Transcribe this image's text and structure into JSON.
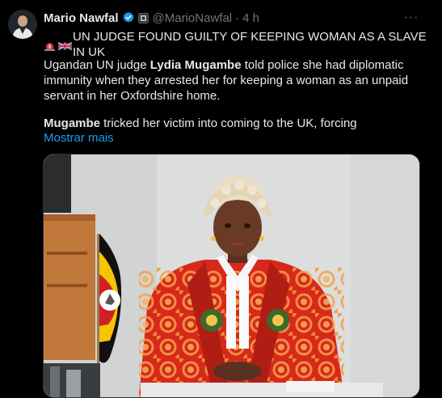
{
  "tweet": {
    "author_name": "Mario Nawfal",
    "handle": "@MarioNawfal",
    "separator": "·",
    "time": "4 h",
    "headline": "UN JUDGE FOUND GUILTY OF KEEPING WOMAN AS A SLAVE IN UK",
    "para1_pre": "Ugandan UN judge ",
    "para1_bold": "Lydia Mugambe",
    "para1_post": " told police she had diplomatic immunity when they arrested her for keeping a woman as an unpaid servant in her Oxfordshire home.",
    "para2_bold": "Mugambe",
    "para2_post": " tricked her victim into coming to the UK, forcing",
    "show_more": "Mostrar mais",
    "more_icon": "···"
  },
  "icons": {
    "verified": "verified-badge-icon",
    "affiliation": "affiliate-badge-icon",
    "siren": "siren-emoji-icon",
    "uk_flag": "uk-flag-emoji-icon"
  },
  "colors": {
    "background": "#000000",
    "text": "#e7e9ea",
    "muted": "#71767b",
    "link": "#1d9bf0",
    "verified": "#1d9bf0",
    "robe": "#d92b1e",
    "wig": "#e8dcc3"
  }
}
